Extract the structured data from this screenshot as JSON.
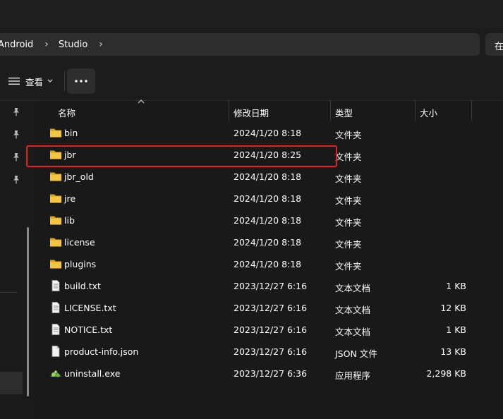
{
  "breadcrumb": {
    "items": [
      "Android",
      "Studio"
    ]
  },
  "search": {
    "partial_text": "在"
  },
  "commandbar": {
    "view_label": "查看",
    "more_label": "···"
  },
  "columns": {
    "name": "名称",
    "date": "修改日期",
    "type": "类型",
    "size": "大小"
  },
  "files": [
    {
      "name": "bin",
      "date": "2024/1/20 8:18",
      "type": "文件夹",
      "size": "",
      "icon": "folder-icon"
    },
    {
      "name": "jbr",
      "date": "2024/1/20 8:25",
      "type": "文件夹",
      "size": "",
      "icon": "folder-icon",
      "highlighted": true
    },
    {
      "name": "jbr_old",
      "date": "2024/1/20 8:18",
      "type": "文件夹",
      "size": "",
      "icon": "folder-icon"
    },
    {
      "name": "jre",
      "date": "2024/1/20 8:18",
      "type": "文件夹",
      "size": "",
      "icon": "folder-icon"
    },
    {
      "name": "lib",
      "date": "2024/1/20 8:18",
      "type": "文件夹",
      "size": "",
      "icon": "folder-icon"
    },
    {
      "name": "license",
      "date": "2024/1/20 8:18",
      "type": "文件夹",
      "size": "",
      "icon": "folder-icon"
    },
    {
      "name": "plugins",
      "date": "2024/1/20 8:18",
      "type": "文件夹",
      "size": "",
      "icon": "folder-icon"
    },
    {
      "name": "build.txt",
      "date": "2023/12/27 6:16",
      "type": "文本文档",
      "size": "1 KB",
      "icon": "text-document-icon"
    },
    {
      "name": "LICENSE.txt",
      "date": "2023/12/27 6:16",
      "type": "文本文档",
      "size": "12 KB",
      "icon": "text-document-icon"
    },
    {
      "name": "NOTICE.txt",
      "date": "2023/12/27 6:16",
      "type": "文本文档",
      "size": "1 KB",
      "icon": "text-document-icon"
    },
    {
      "name": "product-info.json",
      "date": "2023/12/27 6:16",
      "type": "JSON 文件",
      "size": "13 KB",
      "icon": "blank-file-icon"
    },
    {
      "name": "uninstall.exe",
      "date": "2023/12/27 6:36",
      "type": "应用程序",
      "size": "2,298 KB",
      "icon": "uninstaller-icon"
    }
  ],
  "colors": {
    "background": "#191919",
    "folder": "#f5c542",
    "highlight_border": "#e52222"
  }
}
